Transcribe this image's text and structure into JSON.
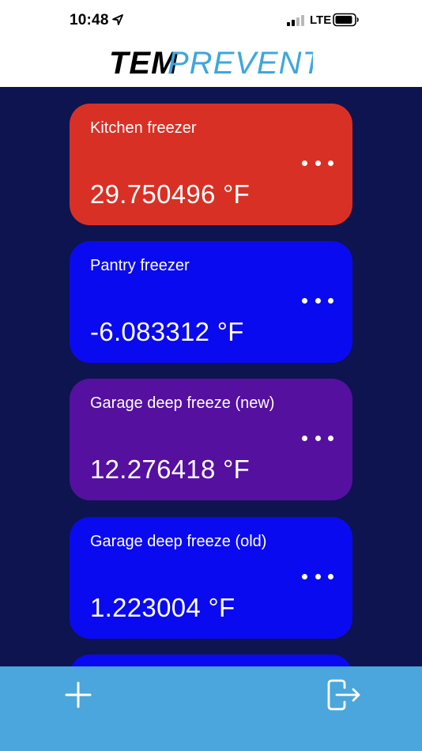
{
  "status_bar": {
    "time": "10:48",
    "network": "LTE",
    "icons": [
      "location-arrow-icon",
      "signal-bars-icon",
      "battery-icon"
    ]
  },
  "header": {
    "logo_part1": "TEM",
    "logo_part2": "PREVENT",
    "logo_colors": {
      "part1": "#000000",
      "part2": "#3fa6dd"
    }
  },
  "colors": {
    "background": "#0d1450",
    "bottom_bar": "#4aa6dc",
    "card_red": "#d93025",
    "card_blue": "#0a0af0",
    "card_purple": "#5510a0"
  },
  "devices": [
    {
      "name": "Kitchen freezer",
      "temperature": "29.750496 °F",
      "color": "#d93025"
    },
    {
      "name": "Pantry freezer",
      "temperature": "-6.083312 °F",
      "color": "#0a0af0"
    },
    {
      "name": "Garage deep freeze (new)",
      "temperature": "12.276418 °F",
      "color": "#5510a0"
    },
    {
      "name": "Garage deep freeze (old)",
      "temperature": "1.223004 °F",
      "color": "#0a0af0"
    },
    {
      "name": "",
      "temperature": "",
      "color": "#0a0af0"
    }
  ],
  "bottom_bar": {
    "icons": [
      "add-icon",
      "logout-icon"
    ]
  }
}
